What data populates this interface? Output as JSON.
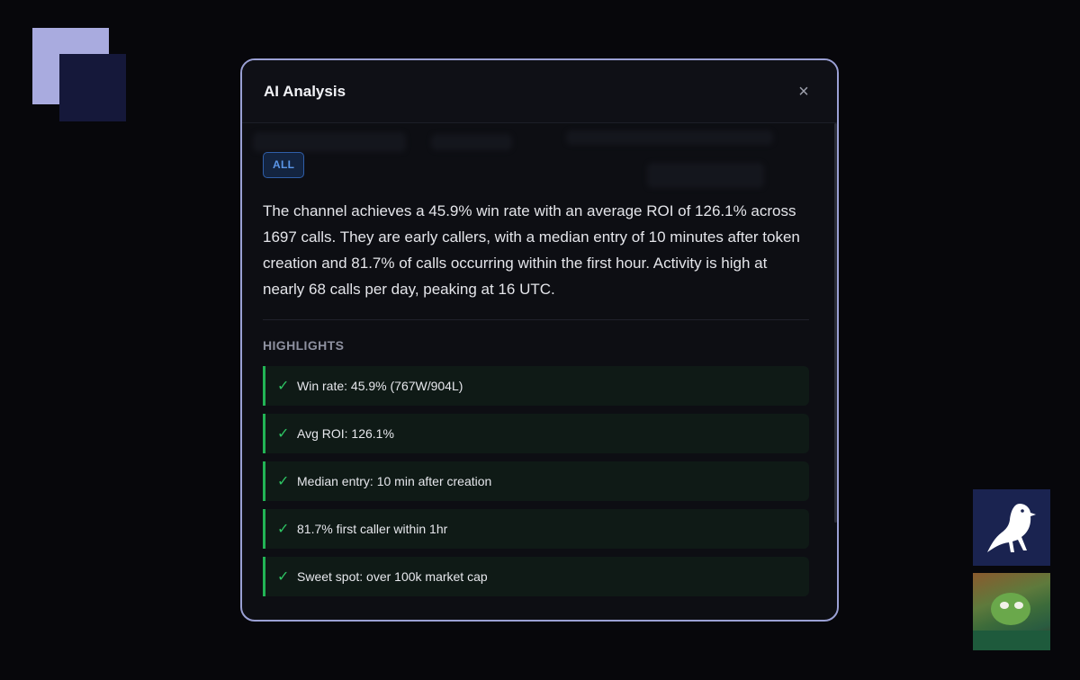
{
  "modal": {
    "title": "AI Analysis",
    "close_symbol": "×",
    "tag": "ALL",
    "summary": "The channel achieves a 45.9% win rate with an average ROI of 126.1% across 1697 calls. They are early callers, with a median entry of 10 minutes after token creation and 81.7% of calls occurring within the first hour. Activity is high at nearly 68 calls per day, peaking at 16 UTC.",
    "highlights_title": "HIGHLIGHTS",
    "check_symbol": "✓",
    "highlights": [
      "Win rate: 45.9% (767W/904L)",
      "Avg ROI: 126.1%",
      "Median entry: 10 min after creation",
      "81.7% first caller within 1hr",
      "Sweet spot: over 100k market cap"
    ]
  },
  "colors": {
    "accent_border": "#9aa0d4",
    "tag_blue": "#5b96e8",
    "highlight_green": "#22b455"
  },
  "icons": {
    "close": "close-icon",
    "check": "check-icon",
    "raven": "raven-icon"
  }
}
